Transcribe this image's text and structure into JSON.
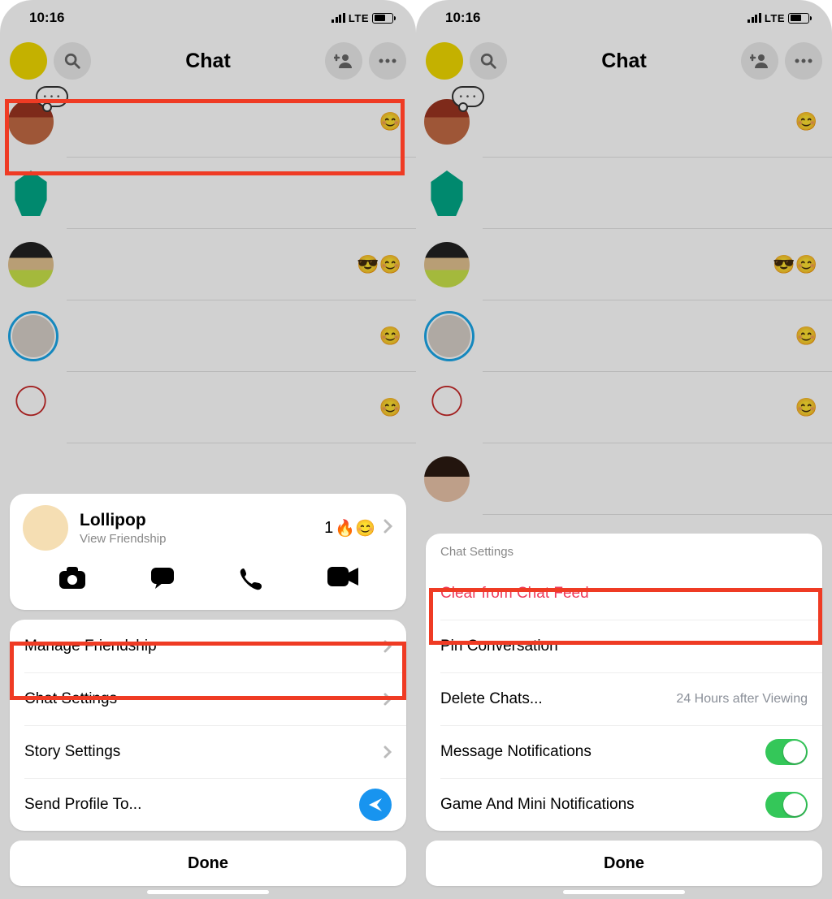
{
  "status": {
    "time": "10:16",
    "network": "LTE"
  },
  "header": {
    "title": "Chat"
  },
  "left": {
    "profile": {
      "name": "Lollipop",
      "subtitle": "View Friendship",
      "streak_count": "1",
      "streak_emojis": "🔥😊"
    },
    "menu": {
      "manage": "Manage Friendship",
      "chat_settings": "Chat Settings",
      "story_settings": "Story Settings",
      "send_profile": "Send Profile To..."
    },
    "done": "Done"
  },
  "right": {
    "sheet_title": "Chat Settings",
    "items": {
      "clear": "Clear from Chat Feed",
      "pin": "Pin Conversation",
      "delete": "Delete Chats...",
      "delete_sub": "24 Hours after Viewing",
      "msg_notif": "Message Notifications",
      "game_notif": "Game And Mini Notifications"
    },
    "done": "Done"
  },
  "chat_emojis": {
    "row1": "😊",
    "row3": "😎😊",
    "row4": "😊",
    "row5": "😊"
  }
}
